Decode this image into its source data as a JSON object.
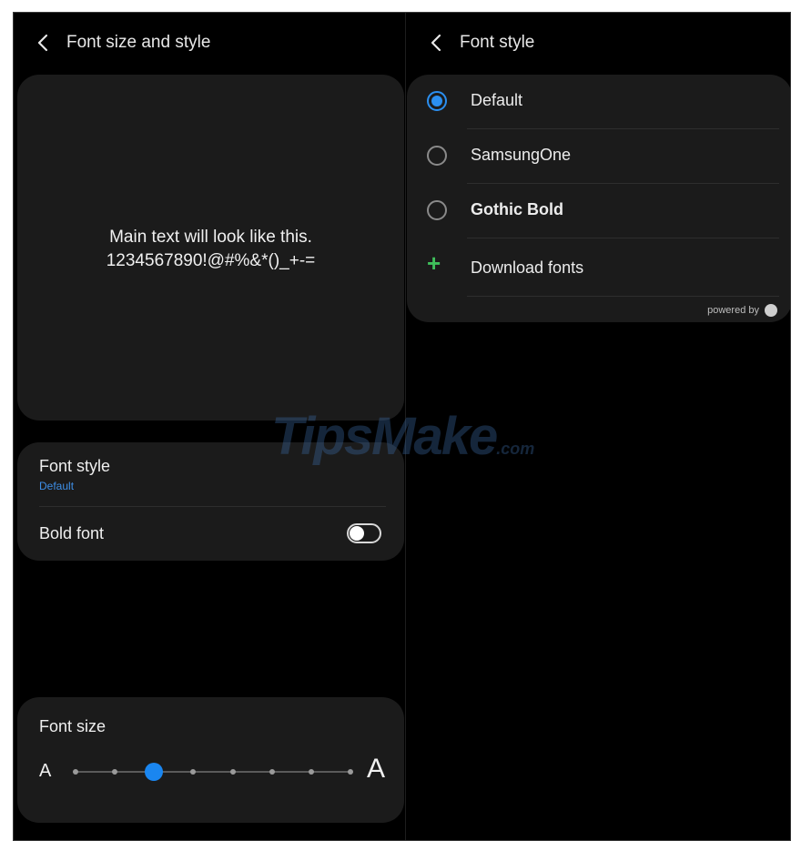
{
  "left": {
    "title": "Font size and style",
    "preview": {
      "line1": "Main text will look like this.",
      "line2": "1234567890!@#%&*()_+-="
    },
    "font_style": {
      "label": "Font style",
      "value": "Default"
    },
    "bold_font": {
      "label": "Bold font",
      "enabled": false
    },
    "font_size": {
      "label": "Font size",
      "small_glyph": "A",
      "large_glyph": "A",
      "steps": 8,
      "selected_step": 3
    }
  },
  "right": {
    "title": "Font style",
    "fonts": [
      {
        "label": "Default",
        "selected": true
      },
      {
        "label": "SamsungOne",
        "selected": false
      },
      {
        "label": "Gothic Bold",
        "selected": false
      }
    ],
    "download": "Download fonts",
    "powered_by": "powered by"
  },
  "watermark": {
    "main": "TipsMake",
    "suffix": ".com"
  },
  "colors": {
    "accent": "#1a86f0",
    "add": "#3fbf5b",
    "background": "#000000",
    "card": "#1b1b1b"
  },
  "icons": {
    "back": "back-chevron-icon",
    "add": "plus-icon"
  }
}
